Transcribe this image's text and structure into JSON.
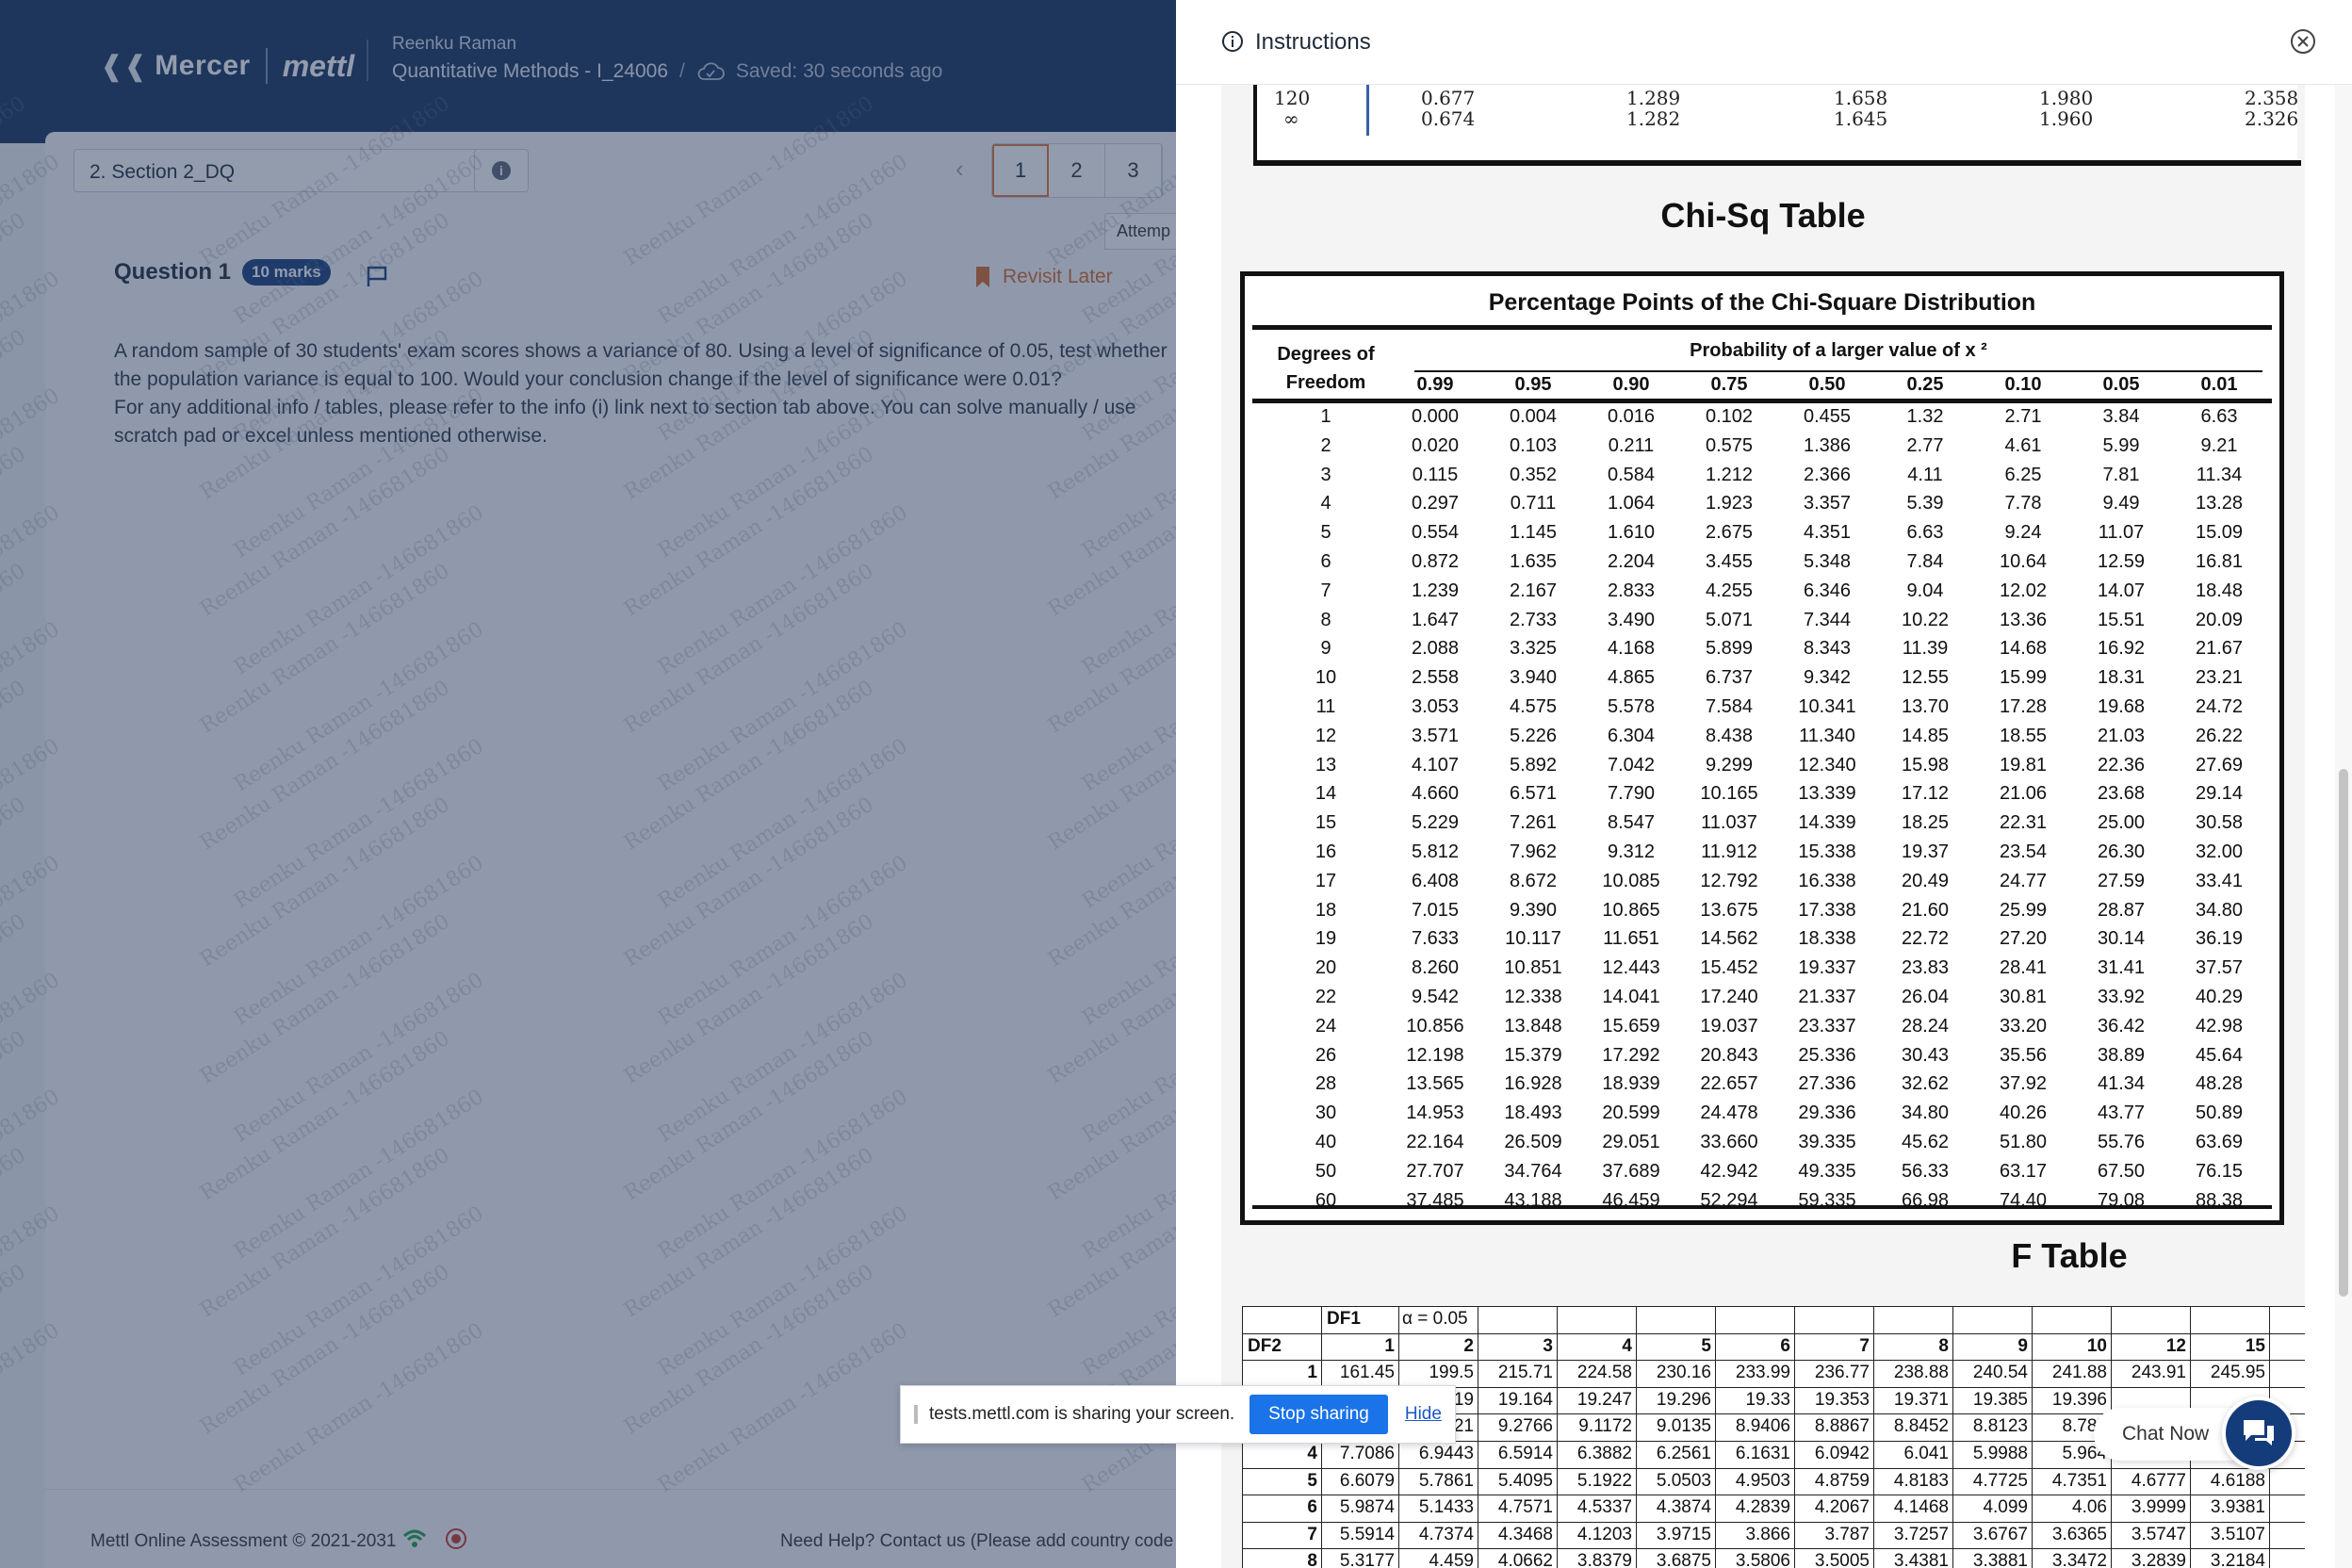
{
  "header": {
    "brand_mercer": "Mercer",
    "brand_mettl": "mettl",
    "user_name": "Reenku Raman",
    "test_name": "Quantitative Methods - I_24006",
    "separator": "/",
    "saved_status": "Saved: 30 seconds ago"
  },
  "toolbar": {
    "section_label": "2. Section 2_DQ",
    "prev_arrow": "‹",
    "question_tabs": [
      "1",
      "2",
      "3"
    ],
    "active_tab": "1",
    "attempt_label": "Attemp"
  },
  "question": {
    "title": "Question 1",
    "marks": "10 marks",
    "revisit_label": "Revisit Later",
    "text_lines": [
      "A random sample of 30 students' exam scores shows a variance of 80. Using a level of significance of 0.05, test whether",
      "the population variance is equal to 100. Would your conclusion change if the level of significance were 0.01?",
      "For any additional info / tables, please refer to the info (i) link next to section tab above. You can solve manually / use",
      "scratch pad or excel unless mentioned otherwise."
    ]
  },
  "footer": {
    "copyright": "Mettl Online Assessment © 2021-2031",
    "help": "Need Help? Contact us (Please add country code whi"
  },
  "watermark": "Reenku Raman -146681860",
  "share_bar": {
    "text": "tests.mettl.com is sharing your screen.",
    "stop_label": "Stop sharing",
    "hide_label": "Hide"
  },
  "panel": {
    "title": "Instructions"
  },
  "t_table_fragment": {
    "rows": [
      {
        "df": "120",
        "values": [
          "0.677",
          "1.289",
          "1.658",
          "1.980",
          "2.358"
        ]
      },
      {
        "df": "∞",
        "values": [
          "0.674",
          "1.282",
          "1.645",
          "1.960",
          "2.326"
        ]
      }
    ]
  },
  "chi_table": {
    "heading": "Chi-Sq Table",
    "title": "Percentage Points of the Chi-Square Distribution",
    "df_header_line1": "Degrees of",
    "df_header_line2": "Freedom",
    "prob_header": "Probability of a larger value of x ²",
    "columns": [
      "0.99",
      "0.95",
      "0.90",
      "0.75",
      "0.50",
      "0.25",
      "0.10",
      "0.05",
      "0.01"
    ],
    "rows": [
      {
        "df": "1",
        "v": [
          "0.000",
          "0.004",
          "0.016",
          "0.102",
          "0.455",
          "1.32",
          "2.71",
          "3.84",
          "6.63"
        ]
      },
      {
        "df": "2",
        "v": [
          "0.020",
          "0.103",
          "0.211",
          "0.575",
          "1.386",
          "2.77",
          "4.61",
          "5.99",
          "9.21"
        ]
      },
      {
        "df": "3",
        "v": [
          "0.115",
          "0.352",
          "0.584",
          "1.212",
          "2.366",
          "4.11",
          "6.25",
          "7.81",
          "11.34"
        ]
      },
      {
        "df": "4",
        "v": [
          "0.297",
          "0.711",
          "1.064",
          "1.923",
          "3.357",
          "5.39",
          "7.78",
          "9.49",
          "13.28"
        ]
      },
      {
        "df": "5",
        "v": [
          "0.554",
          "1.145",
          "1.610",
          "2.675",
          "4.351",
          "6.63",
          "9.24",
          "11.07",
          "15.09"
        ]
      },
      {
        "df": "6",
        "v": [
          "0.872",
          "1.635",
          "2.204",
          "3.455",
          "5.348",
          "7.84",
          "10.64",
          "12.59",
          "16.81"
        ]
      },
      {
        "df": "7",
        "v": [
          "1.239",
          "2.167",
          "2.833",
          "4.255",
          "6.346",
          "9.04",
          "12.02",
          "14.07",
          "18.48"
        ]
      },
      {
        "df": "8",
        "v": [
          "1.647",
          "2.733",
          "3.490",
          "5.071",
          "7.344",
          "10.22",
          "13.36",
          "15.51",
          "20.09"
        ]
      },
      {
        "df": "9",
        "v": [
          "2.088",
          "3.325",
          "4.168",
          "5.899",
          "8.343",
          "11.39",
          "14.68",
          "16.92",
          "21.67"
        ]
      },
      {
        "df": "10",
        "v": [
          "2.558",
          "3.940",
          "4.865",
          "6.737",
          "9.342",
          "12.55",
          "15.99",
          "18.31",
          "23.21"
        ]
      },
      {
        "df": "11",
        "v": [
          "3.053",
          "4.575",
          "5.578",
          "7.584",
          "10.341",
          "13.70",
          "17.28",
          "19.68",
          "24.72"
        ]
      },
      {
        "df": "12",
        "v": [
          "3.571",
          "5.226",
          "6.304",
          "8.438",
          "11.340",
          "14.85",
          "18.55",
          "21.03",
          "26.22"
        ]
      },
      {
        "df": "13",
        "v": [
          "4.107",
          "5.892",
          "7.042",
          "9.299",
          "12.340",
          "15.98",
          "19.81",
          "22.36",
          "27.69"
        ]
      },
      {
        "df": "14",
        "v": [
          "4.660",
          "6.571",
          "7.790",
          "10.165",
          "13.339",
          "17.12",
          "21.06",
          "23.68",
          "29.14"
        ]
      },
      {
        "df": "15",
        "v": [
          "5.229",
          "7.261",
          "8.547",
          "11.037",
          "14.339",
          "18.25",
          "22.31",
          "25.00",
          "30.58"
        ]
      },
      {
        "df": "16",
        "v": [
          "5.812",
          "7.962",
          "9.312",
          "11.912",
          "15.338",
          "19.37",
          "23.54",
          "26.30",
          "32.00"
        ]
      },
      {
        "df": "17",
        "v": [
          "6.408",
          "8.672",
          "10.085",
          "12.792",
          "16.338",
          "20.49",
          "24.77",
          "27.59",
          "33.41"
        ]
      },
      {
        "df": "18",
        "v": [
          "7.015",
          "9.390",
          "10.865",
          "13.675",
          "17.338",
          "21.60",
          "25.99",
          "28.87",
          "34.80"
        ]
      },
      {
        "df": "19",
        "v": [
          "7.633",
          "10.117",
          "11.651",
          "14.562",
          "18.338",
          "22.72",
          "27.20",
          "30.14",
          "36.19"
        ]
      },
      {
        "df": "20",
        "v": [
          "8.260",
          "10.851",
          "12.443",
          "15.452",
          "19.337",
          "23.83",
          "28.41",
          "31.41",
          "37.57"
        ]
      },
      {
        "df": "22",
        "v": [
          "9.542",
          "12.338",
          "14.041",
          "17.240",
          "21.337",
          "26.04",
          "30.81",
          "33.92",
          "40.29"
        ]
      },
      {
        "df": "24",
        "v": [
          "10.856",
          "13.848",
          "15.659",
          "19.037",
          "23.337",
          "28.24",
          "33.20",
          "36.42",
          "42.98"
        ]
      },
      {
        "df": "26",
        "v": [
          "12.198",
          "15.379",
          "17.292",
          "20.843",
          "25.336",
          "30.43",
          "35.56",
          "38.89",
          "45.64"
        ]
      },
      {
        "df": "28",
        "v": [
          "13.565",
          "16.928",
          "18.939",
          "22.657",
          "27.336",
          "32.62",
          "37.92",
          "41.34",
          "48.28"
        ]
      },
      {
        "df": "30",
        "v": [
          "14.953",
          "18.493",
          "20.599",
          "24.478",
          "29.336",
          "34.80",
          "40.26",
          "43.77",
          "50.89"
        ]
      },
      {
        "df": "40",
        "v": [
          "22.164",
          "26.509",
          "29.051",
          "33.660",
          "39.335",
          "45.62",
          "51.80",
          "55.76",
          "63.69"
        ]
      },
      {
        "df": "50",
        "v": [
          "27.707",
          "34.764",
          "37.689",
          "42.942",
          "49.335",
          "56.33",
          "63.17",
          "67.50",
          "76.15"
        ]
      },
      {
        "df": "60",
        "v": [
          "37.485",
          "43.188",
          "46.459",
          "52.294",
          "59.335",
          "66.98",
          "74.40",
          "79.08",
          "88.38"
        ]
      }
    ]
  },
  "f_table": {
    "heading": "F Table",
    "df1_label": "DF1",
    "alpha_label": "α = 0.05",
    "df2_label": "DF2",
    "columns": [
      "1",
      "2",
      "3",
      "4",
      "5",
      "6",
      "7",
      "8",
      "9",
      "10",
      "12",
      "15"
    ],
    "rows": [
      {
        "df2": "1",
        "v": [
          "161.45",
          "199.5",
          "215.71",
          "224.58",
          "230.16",
          "233.99",
          "236.77",
          "238.88",
          "240.54",
          "241.88",
          "243.91",
          "245.95"
        ]
      },
      {
        "df2": "2",
        "v": [
          "",
          "19",
          "19.164",
          "19.247",
          "19.296",
          "19.33",
          "19.353",
          "19.371",
          "19.385",
          "19.396",
          "",
          ""
        ]
      },
      {
        "df2": "3",
        "v": [
          "",
          "21",
          "9.2766",
          "9.1172",
          "9.0135",
          "8.9406",
          "8.8867",
          "8.8452",
          "8.8123",
          "8.785",
          "",
          ""
        ]
      },
      {
        "df2": "4",
        "v": [
          "7.7086",
          "6.9443",
          "6.5914",
          "6.3882",
          "6.2561",
          "6.1631",
          "6.0942",
          "6.041",
          "5.9988",
          "5.964",
          "",
          ""
        ]
      },
      {
        "df2": "5",
        "v": [
          "6.6079",
          "5.7861",
          "5.4095",
          "5.1922",
          "5.0503",
          "4.9503",
          "4.8759",
          "4.8183",
          "4.7725",
          "4.7351",
          "4.6777",
          "4.6188"
        ]
      },
      {
        "df2": "6",
        "v": [
          "5.9874",
          "5.1433",
          "4.7571",
          "4.5337",
          "4.3874",
          "4.2839",
          "4.2067",
          "4.1468",
          "4.099",
          "4.06",
          "3.9999",
          "3.9381"
        ]
      },
      {
        "df2": "7",
        "v": [
          "5.5914",
          "4.7374",
          "4.3468",
          "4.1203",
          "3.9715",
          "3.866",
          "3.787",
          "3.7257",
          "3.6767",
          "3.6365",
          "3.5747",
          "3.5107"
        ]
      },
      {
        "df2": "8",
        "v": [
          "5.3177",
          "4.459",
          "4.0662",
          "3.8379",
          "3.6875",
          "3.5806",
          "3.5005",
          "3.4381",
          "3.3881",
          "3.3472",
          "3.2839",
          "3.2184"
        ]
      }
    ]
  },
  "chat": {
    "label": "Chat Now"
  }
}
